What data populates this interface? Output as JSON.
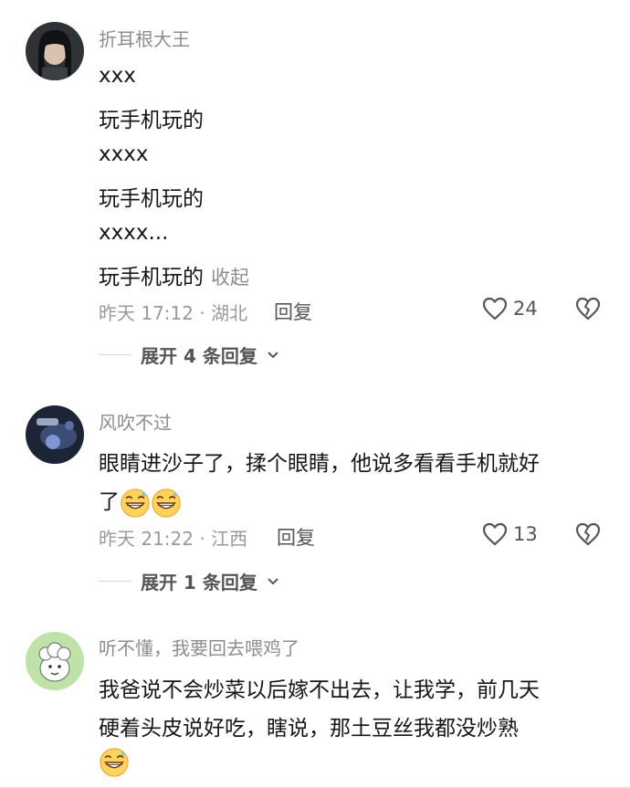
{
  "comments": [
    {
      "username": "折耳根大王",
      "lines": [
        "xxx",
        "玩手机玩的",
        "xxxx",
        "玩手机玩的",
        "xxxx...",
        "玩手机玩的"
      ],
      "collapse_label": "收起",
      "meta": "昨天 17:12 · 湖北",
      "reply_label": "回复",
      "likes": "24",
      "expand_label": "展开 4 条回复"
    },
    {
      "username": "风吹不过",
      "lines": [
        "眼睛进沙子了，揉个眼睛，他说多看看手机就好",
        "了"
      ],
      "meta": "昨天 21:22 · 江西",
      "reply_label": "回复",
      "likes": "13",
      "expand_label": "展开 1 条回复"
    },
    {
      "username": "听不懂，我要回去喂鸡了",
      "lines": [
        "我爸说不会炒菜以后嫁不出去，让我学，前几天",
        "硬着头皮说好吃，瞎说，那土豆丝我都没炒熟"
      ]
    }
  ],
  "icons": {
    "like": "heart-outline-icon",
    "dislike": "broken-heart-icon",
    "expand": "chevron-down-icon",
    "emoji": "grinning-sweat-emoji"
  },
  "colors": {
    "text": "#161616",
    "muted": "#8d8d8d",
    "action": "#555555"
  }
}
